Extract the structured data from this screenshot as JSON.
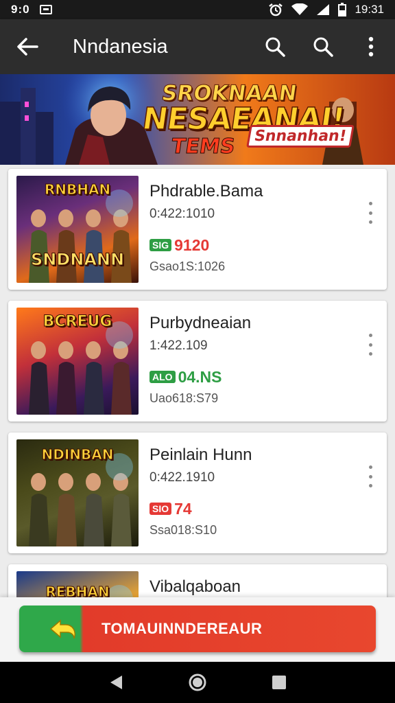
{
  "status_bar": {
    "left_time": "9:0",
    "right_time": "19:31"
  },
  "app_bar": {
    "title": "Nndanesia"
  },
  "banner": {
    "line1": "SROKNAAN",
    "line2": "NESAEANAI!",
    "line3": "TEMS",
    "line4": "Snnanhan!"
  },
  "games": [
    {
      "thumb_title_top": "RNBHAN",
      "thumb_title_bottom": "SNDNANN",
      "title": "Phdrable.Bama",
      "date": "0:422:1010",
      "price_badge": "SIG",
      "price": "9120",
      "price_color": "#e53935",
      "badge_color": "#2e9e44",
      "stat": "Gsao1S:1026"
    },
    {
      "thumb_title_top": "BCREUG",
      "thumb_title_bottom": "",
      "title": "Purbydneaian",
      "date": "1:422.109",
      "price_badge": "ALO",
      "price": "04.NS",
      "price_color": "#2e9e44",
      "badge_color": "#2e9e44",
      "stat": "Uao618:S79"
    },
    {
      "thumb_title_top": "NDINBAN",
      "thumb_title_bottom": "",
      "title": "Peinlain Hunn",
      "date": "0:422.1910",
      "price_badge": "SIO",
      "price": "74",
      "price_color": "#e53935",
      "badge_color": "#e53935",
      "stat": "Ssa018:S10"
    },
    {
      "thumb_title_top": "REBHAN",
      "thumb_title_bottom": "",
      "title": "Vibalqaboan",
      "date": "",
      "price_badge": "",
      "price": "",
      "price_color": "#e53935",
      "badge_color": "#e53935",
      "stat": ""
    }
  ],
  "action": {
    "label": "TOMAUINNDEREAUR"
  },
  "icons": {
    "back": "arrow-left-icon",
    "search": "search-icon",
    "menu": "more-vert-icon",
    "nav_back": "triangle-back-icon",
    "nav_home": "circle-home-icon",
    "nav_recent": "square-recent-icon"
  }
}
